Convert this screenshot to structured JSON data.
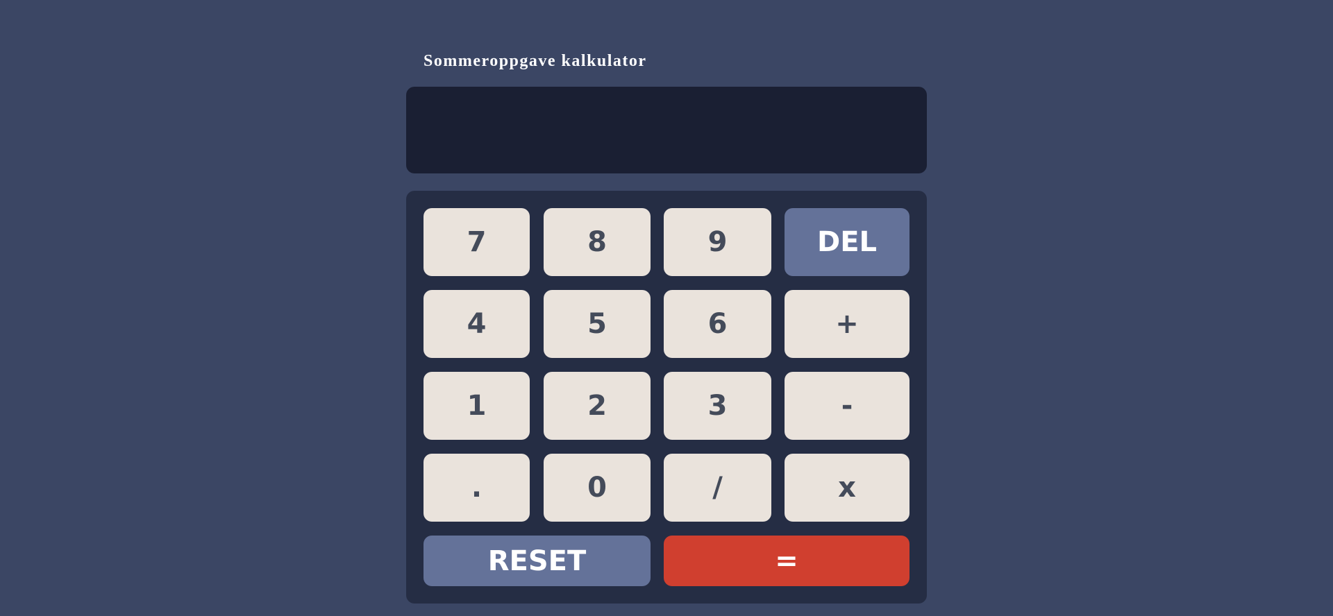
{
  "app": {
    "title": "Sommeroppgave kalkulator"
  },
  "display": {
    "value": ""
  },
  "keys": {
    "seven": "7",
    "eight": "8",
    "nine": "9",
    "del": "DEL",
    "four": "4",
    "five": "5",
    "six": "6",
    "plus": "+",
    "one": "1",
    "two": "2",
    "three": "3",
    "minus": "-",
    "decimal": ".",
    "zero": "0",
    "divide": "/",
    "multiply": "x",
    "reset": "RESET",
    "equals": "="
  },
  "colors": {
    "page_background": "#3b4664",
    "display_background": "#1a1f33",
    "keypad_background": "#252d44",
    "key_background": "#eae3dc",
    "key_text": "#444b5a",
    "function_key": "#647299",
    "equals_key": "#d03f2f"
  }
}
